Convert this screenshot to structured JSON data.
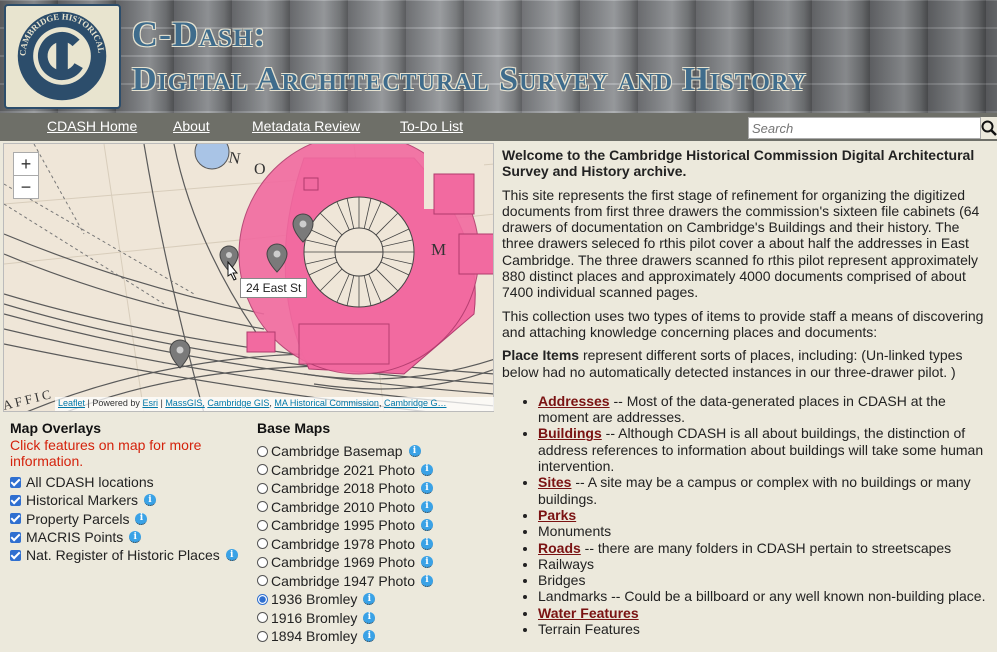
{
  "header": {
    "logo_text": "CAMBRIDGE HISTORICAL COMMISSION",
    "title_line1": "C-Dash:",
    "title_line2": "Digital Architectural Survey and History"
  },
  "nav": {
    "items": [
      "CDASH Home",
      "About",
      "Metadata Review",
      "To-Do List"
    ],
    "search_placeholder": "Search"
  },
  "map": {
    "zoom_in": "+",
    "zoom_out": "−",
    "tooltip": "24 East St",
    "attribution": {
      "leaflet": "Leaflet",
      "powered": "| Powered by",
      "esri": "Esri",
      "sep1": "|",
      "massgis": "MassGIS,",
      "cambridge_gis": "Cambridge GIS",
      "sep2": ",",
      "mhc": "MA Historical Commission",
      "sep3": ",",
      "cambridge_g": "Cambridge G…"
    }
  },
  "overlays": {
    "title": "Map Overlays",
    "note": "Click features on map for more information.",
    "items": [
      {
        "label": "All CDASH locations",
        "checked": true,
        "info": false
      },
      {
        "label": "Historical Markers",
        "checked": true,
        "info": true
      },
      {
        "label": "Property Parcels",
        "checked": true,
        "info": true
      },
      {
        "label": "MACRIS Points",
        "checked": true,
        "info": true
      },
      {
        "label": "Nat. Register of Historic Places",
        "checked": true,
        "info": true
      }
    ]
  },
  "basemaps": {
    "title": "Base Maps",
    "items": [
      {
        "label": "Cambridge Basemap",
        "selected": false
      },
      {
        "label": "Cambridge 2021 Photo",
        "selected": false
      },
      {
        "label": "Cambridge 2018 Photo",
        "selected": false
      },
      {
        "label": "Cambridge 2010 Photo",
        "selected": false
      },
      {
        "label": "Cambridge 1995 Photo",
        "selected": false
      },
      {
        "label": "Cambridge 1978 Photo",
        "selected": false
      },
      {
        "label": "Cambridge 1969 Photo",
        "selected": false
      },
      {
        "label": "Cambridge 1947 Photo",
        "selected": false
      },
      {
        "label": "1936 Bromley",
        "selected": true
      },
      {
        "label": "1916 Bromley",
        "selected": false
      },
      {
        "label": "1894 Bromley",
        "selected": false
      }
    ]
  },
  "content": {
    "welcome": "Welcome to the Cambridge Historical Commission Digital Architectural Survey and History archive.",
    "p1": "This site represents the first stage of refinement for organizing the digitized documents from first three drawers the commission's  sixteen file cabinets (64 drawers of documentation on Cambridge's Buildings and their history. The three drawers seleced fo rthis pilot cover a about half the addresses in East Cambridge.  The three drawers scanned fo rthis pilot  represent approximately 880 distinct places and approximately 4000 documents comprised of  about 7400 individual scanned pages.",
    "p2": "This collection uses two types of items to provide staff a means of discovering and attaching knowledge concerning places and documents:",
    "place_items_label": "Place Items",
    "place_items_text": " represent different sorts of places, including: (Un-linked types below had no automatically detected instances in our three-drawer pilot. )",
    "list": [
      {
        "kw": "Addresses",
        "text": " -- Most of the data-generated places in CDASH at the moment are addresses."
      },
      {
        "kw": "Buildings",
        "text": " -- Although CDASH is all about buildings, the distinction of address references to information about buildings will take some human intervention."
      },
      {
        "kw": "Sites",
        "text": " -- A site may be a campus or complex with no buildings or many buildings."
      },
      {
        "kw": "Parks",
        "text": ""
      },
      {
        "kw": "",
        "text": "Monuments"
      },
      {
        "kw": "Roads",
        "text": " -- there are many folders in CDASH pertain to streetscapes"
      },
      {
        "kw": "",
        "text": "Railways"
      },
      {
        "kw": "",
        "text": "Bridges"
      },
      {
        "kw": "",
        "text": "Landmarks  --  Could be a billboard or any well known non-building place."
      },
      {
        "kw": "Water Features",
        "text": ""
      },
      {
        "kw": "",
        "text": "Terrain Features"
      }
    ]
  },
  "colors": {
    "nav_bg": "#6e6f68",
    "page_bg": "#ece9dc",
    "keyword": "#7a1212",
    "note_red": "#d4220c",
    "title_blue": "#3f6c8c",
    "pink_parcel": "#f26aa0"
  }
}
